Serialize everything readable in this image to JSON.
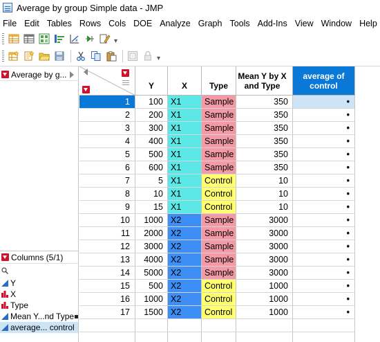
{
  "window": {
    "title": "Average by group Simple data - JMP"
  },
  "menu": [
    "File",
    "Edit",
    "Tables",
    "Rows",
    "Cols",
    "DOE",
    "Analyze",
    "Graph",
    "Tools",
    "Add-Ins",
    "View",
    "Window",
    "Help"
  ],
  "colors": {
    "accent": "#0a78d7",
    "x1": "#5de8e8",
    "x2": "#3d8ef5",
    "sample": "#f49aa6",
    "control": "#ffff70",
    "hot_triangle": "#d0112b",
    "selection": "#cde4f7"
  },
  "left_panel": {
    "table_name": "Average by g...",
    "columns_header": "Columns (5/1)",
    "columns": [
      {
        "label": "Y",
        "type": "continuous-icon"
      },
      {
        "label": "X",
        "type": "nominal-icon"
      },
      {
        "label": "Type",
        "type": "nominal-icon"
      },
      {
        "label": "Mean Y...nd Type",
        "type": "continuous-icon",
        "formula": true
      },
      {
        "label": "average... control",
        "type": "continuous-icon",
        "selected": true
      }
    ]
  },
  "grid": {
    "headers": {
      "y": "Y",
      "x": "X",
      "type": "Type",
      "mean": "Mean Y by X and Type",
      "avg": "average of control"
    },
    "rows": [
      {
        "n": "1",
        "y": "100",
        "x": "X1",
        "type": "Sample",
        "mean": "350",
        "avg": "•"
      },
      {
        "n": "2",
        "y": "200",
        "x": "X1",
        "type": "Sample",
        "mean": "350",
        "avg": "•"
      },
      {
        "n": "3",
        "y": "300",
        "x": "X1",
        "type": "Sample",
        "mean": "350",
        "avg": "•"
      },
      {
        "n": "4",
        "y": "400",
        "x": "X1",
        "type": "Sample",
        "mean": "350",
        "avg": "•"
      },
      {
        "n": "5",
        "y": "500",
        "x": "X1",
        "type": "Sample",
        "mean": "350",
        "avg": "•"
      },
      {
        "n": "6",
        "y": "600",
        "x": "X1",
        "type": "Sample",
        "mean": "350",
        "avg": "•"
      },
      {
        "n": "7",
        "y": "5",
        "x": "X1",
        "type": "Control",
        "mean": "10",
        "avg": "•"
      },
      {
        "n": "8",
        "y": "10",
        "x": "X1",
        "type": "Control",
        "mean": "10",
        "avg": "•"
      },
      {
        "n": "9",
        "y": "15",
        "x": "X1",
        "type": "Control",
        "mean": "10",
        "avg": "•"
      },
      {
        "n": "10",
        "y": "1000",
        "x": "X2",
        "type": "Sample",
        "mean": "3000",
        "avg": "•"
      },
      {
        "n": "11",
        "y": "2000",
        "x": "X2",
        "type": "Sample",
        "mean": "3000",
        "avg": "•"
      },
      {
        "n": "12",
        "y": "3000",
        "x": "X2",
        "type": "Sample",
        "mean": "3000",
        "avg": "•"
      },
      {
        "n": "13",
        "y": "4000",
        "x": "X2",
        "type": "Sample",
        "mean": "3000",
        "avg": "•"
      },
      {
        "n": "14",
        "y": "5000",
        "x": "X2",
        "type": "Sample",
        "mean": "3000",
        "avg": "•"
      },
      {
        "n": "15",
        "y": "500",
        "x": "X2",
        "type": "Control",
        "mean": "1000",
        "avg": "•"
      },
      {
        "n": "16",
        "y": "1000",
        "x": "X2",
        "type": "Control",
        "mean": "1000",
        "avg": "•"
      },
      {
        "n": "17",
        "y": "1500",
        "x": "X2",
        "type": "Control",
        "mean": "1000",
        "avg": "•"
      }
    ],
    "selected_row": 0
  }
}
